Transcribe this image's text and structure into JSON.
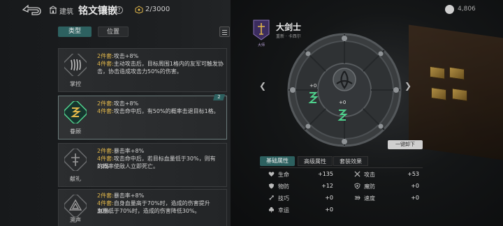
{
  "topbar": {
    "build_label": "建筑",
    "title": "铭文镶嵌",
    "help": "?",
    "capacity": "2/3000",
    "currency": "4,806"
  },
  "tabs": {
    "type": "类型",
    "position": "位置"
  },
  "cards": [
    {
      "name": "掌控",
      "lines": [
        {
          "key": "2件套:",
          "value": "攻击+8%"
        },
        {
          "key": "4件套:",
          "value": "主动攻击后，目标周围1格内的友军可触发协"
        },
        {
          "key": "",
          "value": "击，协击造成攻击力50%的伤害。"
        }
      ]
    },
    {
      "name": "眷顾",
      "badge": "2",
      "lines": [
        {
          "key": "2件套:",
          "value": "攻击+8%"
        },
        {
          "key": "4件套:",
          "value": "攻击命中后，有50%的概率击退目标1格。"
        }
      ]
    },
    {
      "name": "献礼",
      "lines": [
        {
          "key": "2件套:",
          "value": "暴击率+8%"
        },
        {
          "key": "4件套:",
          "value": "攻击命中后，若目标血量低于30%，则有10%"
        },
        {
          "key": "",
          "value": "的概率使敌人立即死亡。"
        }
      ]
    },
    {
      "name": "溯声",
      "lines": [
        {
          "key": "2件套:",
          "value": "暴击率+8%"
        },
        {
          "key": "4件套:",
          "value": "自身血量高于70%时，造成的伤害提升30%，"
        },
        {
          "key": "",
          "value": "血量低于70%时，造成的伤害降低30%。"
        }
      ]
    }
  ],
  "hero": {
    "badge_label": "大师",
    "name": "大剑士",
    "sub": "重新 · 卡西尔"
  },
  "wheel": {
    "slot_a": "+0",
    "slot_b": "+0"
  },
  "unequip_label": "一键卸下",
  "attr_tabs": {
    "basic": "基础属性",
    "advanced": "高级属性",
    "set": "套装效果"
  },
  "stats": [
    {
      "label": "生命",
      "value": "+135",
      "icon": "heart-icon"
    },
    {
      "label": "攻击",
      "value": "+53",
      "icon": "sword-icon"
    },
    {
      "label": "物防",
      "value": "+12",
      "icon": "shield-icon"
    },
    {
      "label": "魔防",
      "value": "+0",
      "icon": "magic-shield-icon"
    },
    {
      "label": "技巧",
      "value": "+0",
      "icon": "skill-icon"
    },
    {
      "label": "速度",
      "value": "+0",
      "icon": "speed-icon"
    },
    {
      "label": "幸运",
      "value": "+0",
      "icon": "clover-icon"
    }
  ],
  "colors": {
    "accent": "#2d6160",
    "gold": "#e0b64a",
    "jade": "#4fd08c"
  }
}
